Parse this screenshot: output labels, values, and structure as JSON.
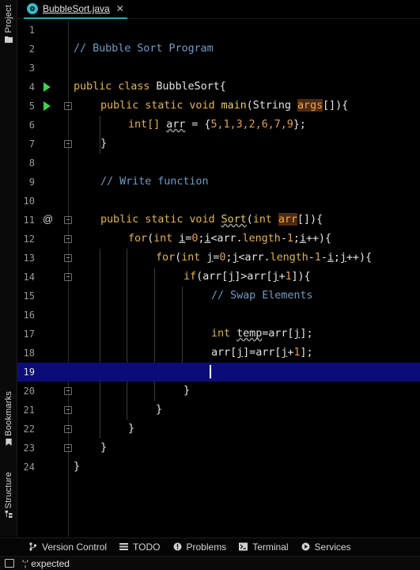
{
  "tabs": [
    {
      "label": "BubbleSort.java",
      "icon": "java-class-icon",
      "active": true
    }
  ],
  "side_tabs": {
    "project": "Project",
    "bookmarks": "Bookmarks",
    "structure": "Structure"
  },
  "editor": {
    "current_line": 19,
    "line_numbers": [
      "1",
      "2",
      "3",
      "4",
      "5",
      "6",
      "7",
      "8",
      "9",
      "10",
      "11",
      "12",
      "13",
      "14",
      "15",
      "16",
      "17",
      "18",
      "19",
      "20",
      "21",
      "22",
      "23",
      "24"
    ],
    "code": {
      "comment_title": "// Bubble Sort Program",
      "class_decl": {
        "kw": "public class ",
        "name": "BubbleSort",
        "brace": "{"
      },
      "main_decl": {
        "kw": "public static void ",
        "name": "main",
        "open": "(String ",
        "param": "args",
        "close": "[]){"
      },
      "arr_decl": {
        "type": "int[] ",
        "var": "arr",
        "eq": " = {",
        "values": "5,1,3,2,6,7,9",
        "end": "};"
      },
      "close_brace": "}",
      "comment_write": "// Write function",
      "sort_decl": {
        "kw": "public static void ",
        "name": "Sort",
        "open": "(",
        "ptype": "int ",
        "param": "arr",
        "close": "[]){"
      },
      "for_i": {
        "kw": "for",
        "a": "(",
        "t": "int ",
        "v1": "i",
        "b": "=",
        "z": "0",
        "c": ";",
        "v2": "i",
        "d": "<arr.",
        "len": "length",
        "e": "-",
        "one": "1",
        "f": ";",
        "v3": "i",
        "g": "++){"
      },
      "for_j": {
        "kw": "for",
        "a": "(",
        "t": "int ",
        "v1": "j",
        "b": "=",
        "z": "0",
        "c": ";",
        "v2": "j",
        "d": "<arr.",
        "len": "length",
        "e": "-",
        "one": "1",
        "m": "-",
        "v4": "i",
        "f": ";",
        "v3": "j",
        "g": "++){"
      },
      "if_stmt": {
        "kw": "if",
        "a": "(arr[",
        "v1": "j",
        "b": "]>arr[",
        "v2": "j",
        "c": "+",
        "one": "1",
        "d": "]){"
      },
      "comment_swap": "// Swap Elements",
      "temp_stmt": {
        "t": "int ",
        "var": "temp",
        "a": "=arr[",
        "v": "j",
        "b": "];"
      },
      "assign_stmt": {
        "a": "arr[",
        "v1": "j",
        "b": "]=arr[",
        "v2": "j",
        "c": "+",
        "one": "1",
        "d": "];"
      }
    }
  },
  "tool_windows": [
    {
      "label": "Version Control",
      "icon": "version-control-icon"
    },
    {
      "label": "TODO",
      "icon": "todo-icon"
    },
    {
      "label": "Problems",
      "icon": "problems-icon"
    },
    {
      "label": "Terminal",
      "icon": "terminal-icon"
    },
    {
      "label": "Services",
      "icon": "services-icon"
    }
  ],
  "status": {
    "message": "';' expected"
  },
  "colors": {
    "current_line": "#0c0c78",
    "keyword": "#e0b15a",
    "comment": "#6f9bc5",
    "number": "#e09c5a",
    "run_gutter": "#3fd24d",
    "tab_accent": "#2fa7b4"
  }
}
